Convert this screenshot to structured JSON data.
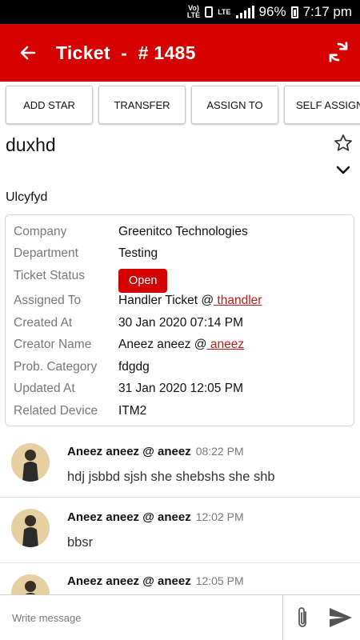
{
  "status_bar": {
    "volte": "Vo)) LTE",
    "lte": "LTE",
    "battery": "96%",
    "time": "7:17 pm"
  },
  "app_bar": {
    "title": "Ticket  -  # 1485",
    "background": "#d50000"
  },
  "actions": [
    {
      "label": "ADD STAR"
    },
    {
      "label": "TRANSFER"
    },
    {
      "label": "ASSIGN TO"
    },
    {
      "label": "SELF ASSIGN"
    }
  ],
  "ticket": {
    "subject": "duxhd",
    "description": "Ulcyfyd",
    "details": {
      "company_label": "Company",
      "company": "Greenitco Technologies",
      "department_label": "Department",
      "department": "Testing",
      "status_label": "Ticket Status",
      "status": "Open",
      "assigned_label": "Assigned To",
      "assigned_name": "Handler Ticket @",
      "assigned_handle": " thandler",
      "created_at_label": "Created At",
      "created_at": "30 Jan 2020 07:14 PM",
      "creator_label": "Creator Name",
      "creator_name": "Aneez aneez @",
      "creator_handle": " aneez",
      "category_label": "Prob. Category",
      "category": "fdgdg",
      "updated_at_label": "Updated At",
      "updated_at": "31 Jan 2020 12:05 PM",
      "device_label": "Related Device",
      "device": "ITM2"
    }
  },
  "messages": [
    {
      "author": "Aneez aneez @ aneez",
      "time": "08:22 PM",
      "text": "hdj jsbbd sjsh she shebshs she shb"
    },
    {
      "author": "Aneez aneez @ aneez",
      "time": "12:02 PM",
      "text": "bbsr"
    },
    {
      "author": "Aneez aneez @ aneez",
      "time": "12:05 PM",
      "text": ""
    }
  ],
  "composer": {
    "placeholder": "Write message"
  },
  "icons": {
    "back": "arrow-left-icon",
    "refresh": "refresh-icon",
    "star": "star-outline-icon",
    "expand": "chevron-down-icon",
    "attach": "paperclip-icon",
    "send": "send-icon"
  }
}
